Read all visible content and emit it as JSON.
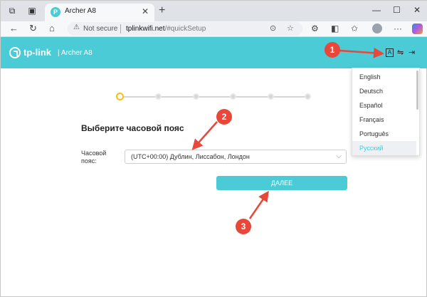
{
  "browser": {
    "tab_title": "Archer A8",
    "not_secure": "Not secure",
    "url_host": "tplinkwifi.net",
    "url_path": "/#quickSetup"
  },
  "header": {
    "brand": "tp-link",
    "model": "| Archer A8",
    "lang_icon_letter": "A"
  },
  "wizard": {
    "steps": 6,
    "active_step": 1,
    "title": "Выберите часовой пояс",
    "tz_label": "Часовой пояс:",
    "tz_value": "(UTC+00:00) Дублин, Лиссабон, Лондон",
    "next_label": "ДАЛЕЕ"
  },
  "language_menu": {
    "items": [
      "English",
      "Deutsch",
      "Español",
      "Français",
      "Português",
      "Русский"
    ],
    "selected": "Русский"
  },
  "annotations": [
    "1",
    "2",
    "3"
  ],
  "colors": {
    "accent": "#4acbd6",
    "annotation": "#e8473a",
    "active_step": "#f0c020"
  }
}
